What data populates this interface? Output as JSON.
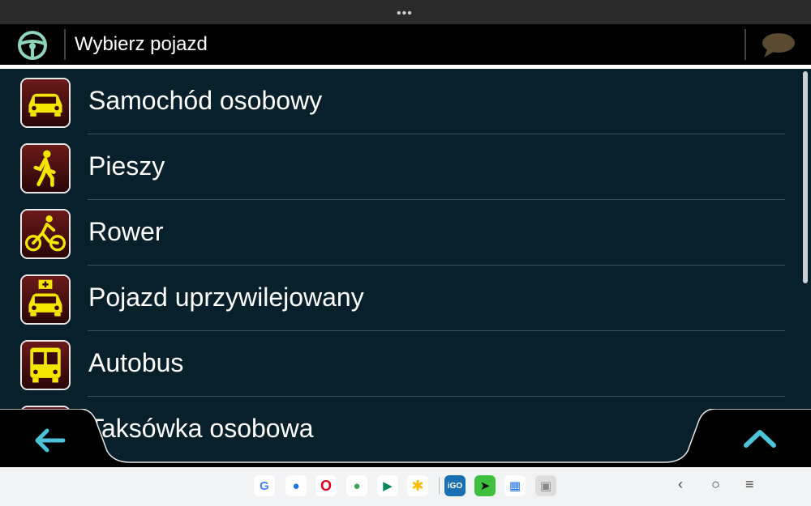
{
  "header": {
    "title": "Wybierz pojazd"
  },
  "vehicles": [
    {
      "label": "Samochód osobowy",
      "icon": "car-icon",
      "color": "#f5e600"
    },
    {
      "label": "Pieszy",
      "icon": "pedestrian-icon",
      "color": "#f5e600"
    },
    {
      "label": "Rower",
      "icon": "bicycle-icon",
      "color": "#f5e600"
    },
    {
      "label": "Pojazd uprzywilejowany",
      "icon": "emergency-vehicle-icon",
      "color": "#f5e600"
    },
    {
      "label": "Autobus",
      "icon": "bus-icon",
      "color": "#f5e600"
    },
    {
      "label": "Taksówka osobowa",
      "icon": "taxi-icon",
      "color": "#f5e600"
    }
  ],
  "taskbar": {
    "apps": [
      {
        "name": "google",
        "glyph": "G"
      },
      {
        "name": "messages",
        "glyph": "●"
      },
      {
        "name": "opera",
        "glyph": "O"
      },
      {
        "name": "assistant",
        "glyph": "●"
      },
      {
        "name": "play-store",
        "glyph": "▶"
      },
      {
        "name": "photos",
        "glyph": "✱"
      },
      {
        "name": "igo",
        "glyph": "iGO"
      },
      {
        "name": "sygic",
        "glyph": "➤"
      },
      {
        "name": "files",
        "glyph": "▦"
      },
      {
        "name": "app-drawer",
        "glyph": "▣"
      }
    ],
    "nav": {
      "back": "‹",
      "home": "○",
      "recents": "≡"
    }
  },
  "colors": {
    "list_bg": "#08202b",
    "accent": "#4cc3d9",
    "icon_yellow": "#f5e600",
    "icon_bg": "#4a1010"
  }
}
